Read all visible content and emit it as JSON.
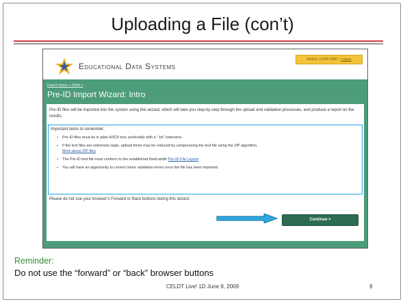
{
  "slide": {
    "title": "Uploading a File (con’t)",
    "reminder_heading": "Reminder:",
    "reminder_text": "Do not use the “forward” or “back” browser buttons",
    "footer": "CELDT Live! 1D June 9, 2009",
    "page_number": "9"
  },
  "app": {
    "logo_text": "Educational Data Systems",
    "user_info": "District: 12345-0000",
    "logout_label": "Logout",
    "breadcrumb": "District Home > PSIM >",
    "page_heading": "Pre-ID Import Wizard: Intro",
    "intro_text": "Pre-ID files will be imported into the system using this wizard, which will take you step-by-step through the upload and validation processes, and produce a report on the results.",
    "important_heading": "Important items to remember:",
    "bullet_1": "Pre-ID files must be in plain ASCII text, preferably with a \".txt\" extension.",
    "bullet_2": "If the text files are extremely large, upload times may be reduced by compressing the text file using the ZIP algorithm.",
    "bullet_2_link": "More about ZIP files",
    "bullet_3_prefix": "The Pre-ID text file must conform to the established fixed-width",
    "bullet_3_link": "Pre-ID File Layout",
    "bullet_4": "You will have an opportunity to correct minor validation errors once the file has been imported.",
    "warning_text": "Please do not use your browser's Forward or Back buttons during this wizard.",
    "continue_label": "Continue >"
  },
  "colors": {
    "accent_green": "#4d9c7a",
    "button_green": "#2d6b50",
    "highlight_blue": "#20a4e4",
    "user_box_yellow": "#f3c43b",
    "reminder_green": "#3a8a3a"
  },
  "icons": {
    "logo": "star-logo-icon",
    "annotation": "arrow-right-icon"
  }
}
